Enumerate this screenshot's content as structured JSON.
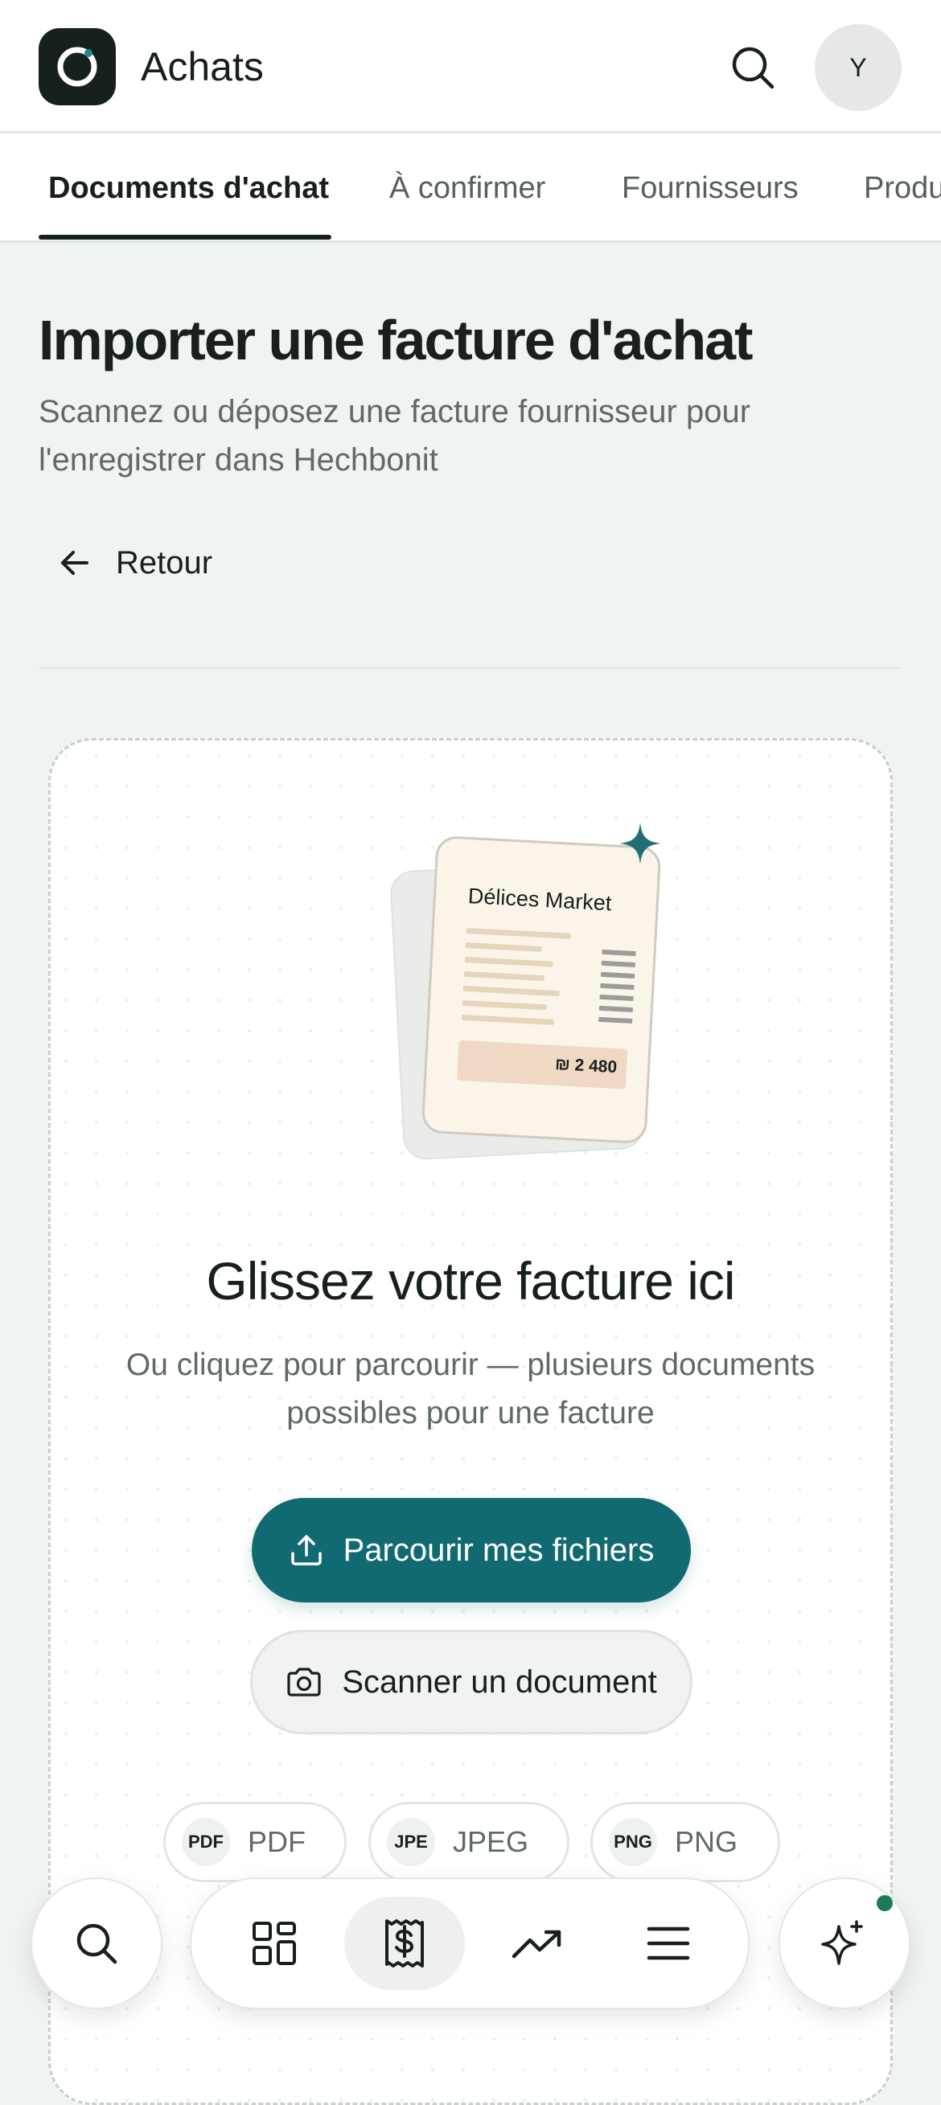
{
  "header": {
    "app_title": "Achats",
    "avatar_initial": "Y",
    "icons": {
      "logo": "ring-logo",
      "search": "search-icon"
    }
  },
  "tabs": [
    {
      "label": "Documents d'achat",
      "active": true
    },
    {
      "label": "À confirmer",
      "active": false
    },
    {
      "label": "Fournisseurs",
      "active": false
    },
    {
      "label": "Produ",
      "active": false
    }
  ],
  "page": {
    "title": "Importer une facture d'achat",
    "subtitle": "Scannez ou déposez une facture fournisseur pour l'enregistrer dans Hechbonit",
    "back_label": "Retour"
  },
  "illustration": {
    "merchant": "Délices Market",
    "total": "₪ 2 480"
  },
  "dropzone": {
    "title": "Glissez votre facture ici",
    "description_line1": "Ou cliquez pour parcourir — plusieurs documents",
    "description_line2": "possibles pour une facture",
    "browse_label": "Parcourir mes fichiers",
    "scan_label": "Scanner un document",
    "formats": [
      {
        "badge": "PDF",
        "name": "PDF"
      },
      {
        "badge": "JPE",
        "name": "JPEG"
      },
      {
        "badge": "PNG",
        "name": "PNG"
      }
    ]
  },
  "bottom_nav": {
    "items": [
      "search-icon",
      "dashboard-icon",
      "receipt-dollar-icon",
      "trending-up-icon",
      "menu-icon",
      "sparkles-icon"
    ],
    "active": "receipt-dollar-icon"
  },
  "colors": {
    "primary": "#116a72",
    "dark": "#17201d",
    "background": "#f0f4f1",
    "notification_dot": "#1d7a55"
  }
}
